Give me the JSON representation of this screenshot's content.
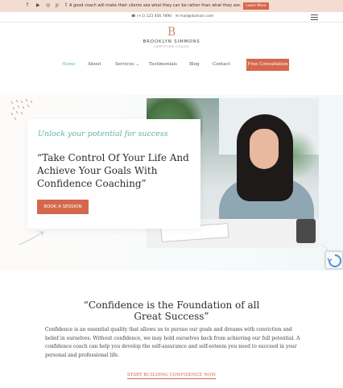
{
  "colors": {
    "accent": "#d5684c",
    "teal": "#5fb3a8",
    "topbar_bg": "#f3ddd3",
    "text_dark": "#2c2c2c"
  },
  "topbar": {
    "social_icons": [
      "facebook-icon",
      "youtube-icon",
      "instagram-icon",
      "pinterest-icon",
      "twitter-icon"
    ],
    "quote": "A good coach will make their clients see what they can be rather than what they are.",
    "learn_more": "Learn More"
  },
  "contact": {
    "phone": "(+1) 123 456 7890",
    "email": "mail@domain.com"
  },
  "logo": {
    "mark": "B",
    "name": "BROOKLYN SIMMONS",
    "subtitle": "CERTIFIED COACH"
  },
  "nav": {
    "items": [
      "Home",
      "About",
      "Services",
      "Testimonials",
      "Blog",
      "Contact"
    ],
    "cta": "Free Consultation"
  },
  "hero": {
    "script": "Unlock your potential for success",
    "headline": "“Take Control Of Your Life And Achieve Your Goals With Confidence Coaching”",
    "button": "BOOK A SESSION"
  },
  "section2": {
    "title_line1": "“Confidence is the Foundation of all",
    "title_line2": "Great Success”",
    "body": "Confidence is an essential quality that allows us to pursue our goals and dreams with conviction and belief in ourselves. Without confidence, we may hold ourselves back from achieving our full potential. A confidence coach can help you develop the self-assurance and self-esteem you need to succeed in your personal and professional life.",
    "link": "START BUILDING CONFIDENCE NOW"
  }
}
